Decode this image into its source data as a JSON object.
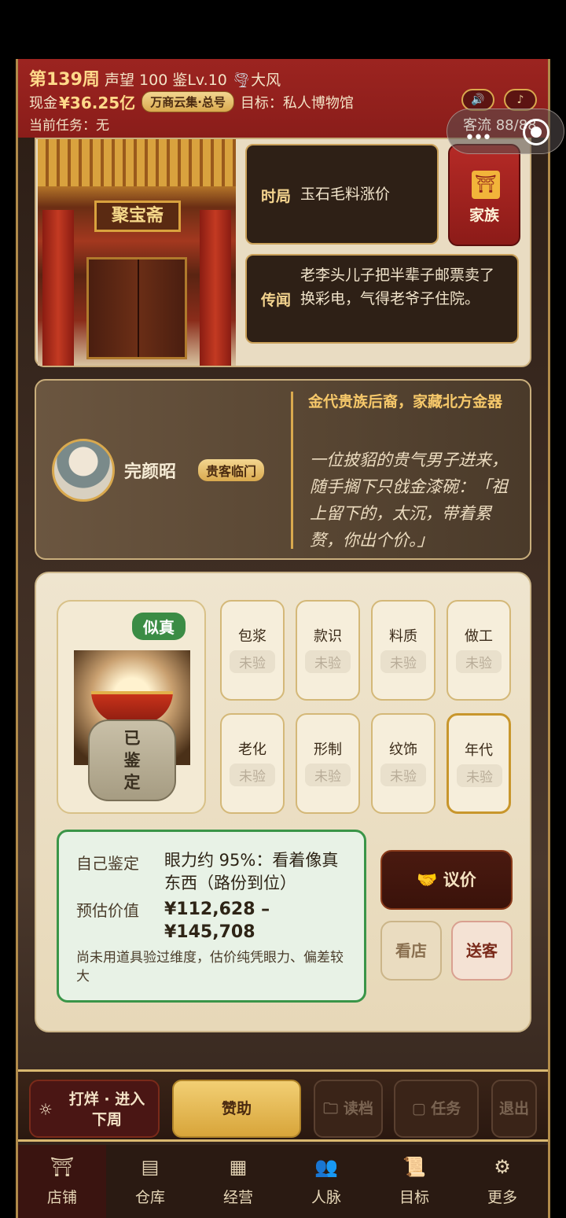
{
  "header": {
    "week": "第139周",
    "stats": "声望 100  鉴Lv.10",
    "weather_icon": "tornado-icon",
    "weather": "大风",
    "cash_label": "现金",
    "cash": "¥36.25亿",
    "rank_badge": "万商云集·总号",
    "goal": "目标：私人博物馆",
    "task": "当前任务：无",
    "sound_icon": "speaker-icon",
    "music_icon": "music-note-icon"
  },
  "overlay": {
    "traffic": "客流 88/88"
  },
  "shop": {
    "sign": "聚宝斋"
  },
  "news": [
    {
      "tag": "时局",
      "text": "玉石毛料涨价"
    },
    {
      "tag": "传闻",
      "text": "老李头儿子把半辈子邮票卖了换彩电，气得老爷子住院。"
    }
  ],
  "family_button": {
    "label": "家族",
    "icon": "family-hall-icon"
  },
  "visitor": {
    "name": "完颜昭",
    "badge": "贵客临门",
    "title": "金代贵族后裔，家藏北方金器",
    "story": "一位披貂的贵气男子进来，随手搁下只戗金漆碗：「祖上留下的，太沉，带着累赘，你出个价。」"
  },
  "item": {
    "verdict": "似真",
    "identified": "已\n鉴\n定"
  },
  "dimensions": [
    {
      "name": "包浆",
      "status": "未验"
    },
    {
      "name": "款识",
      "status": "未验"
    },
    {
      "name": "料质",
      "status": "未验"
    },
    {
      "name": "做工",
      "status": "未验"
    },
    {
      "name": "老化",
      "status": "未验"
    },
    {
      "name": "形制",
      "status": "未验"
    },
    {
      "name": "纹饰",
      "status": "未验"
    },
    {
      "name": "年代",
      "status": "未验"
    }
  ],
  "appraisal": {
    "self_label": "自己鉴定",
    "self_value": "眼力约 95%：看着像真东西（路份到位）",
    "est_label": "预估价值",
    "est_value": "¥112,628 – ¥145,708",
    "note": "尚未用道具验过维度，估价纯凭眼力、偏差较大"
  },
  "actions": {
    "negotiate": "议价",
    "negotiate_icon": "handshake-icon",
    "browse": "看店",
    "dismiss": "送客"
  },
  "bottom_bar": {
    "next_week": "打烊 · 进入下周",
    "next_week_icon": "sun-icon",
    "sponsor": "赞助",
    "load": "读档",
    "load_icon": "folder-icon",
    "tasks": "任务",
    "tasks_icon": "clipboard-icon",
    "exit": "退出"
  },
  "nav": [
    {
      "label": "店铺",
      "icon": "shop-stall-icon"
    },
    {
      "label": "仓库",
      "icon": "warehouse-chest-icon"
    },
    {
      "label": "经营",
      "icon": "abacus-icon"
    },
    {
      "label": "人脉",
      "icon": "people-icon"
    },
    {
      "label": "目标",
      "icon": "scroll-icon"
    },
    {
      "label": "更多",
      "icon": "more-icon"
    }
  ]
}
